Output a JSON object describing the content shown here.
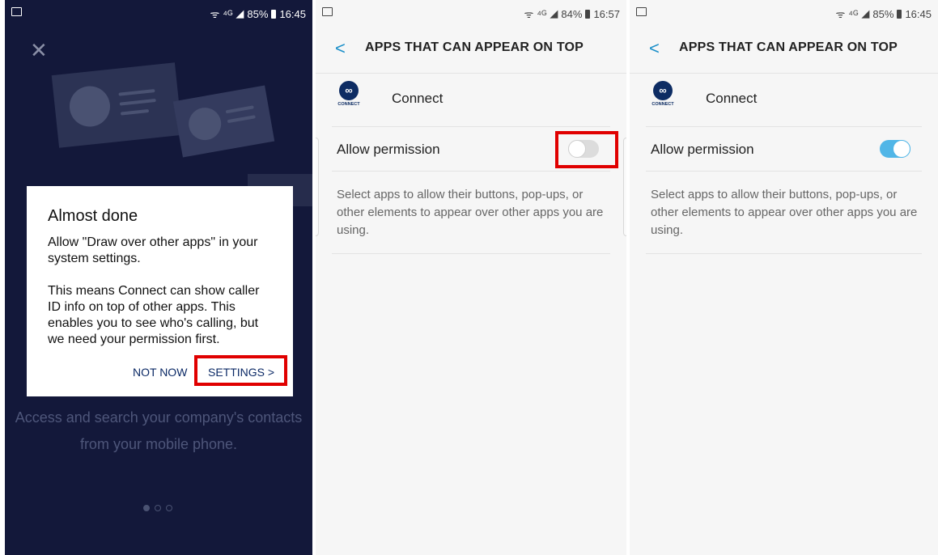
{
  "screen1": {
    "status": {
      "network": "⁴ᴳ",
      "battery": "85%",
      "time": "16:45"
    },
    "close_icon": "✕",
    "dialog": {
      "title": "Almost done",
      "body": "Allow \"Draw over other apps\" in your system settings.\n\nThis means Connect can show caller ID info on top of other apps. This enables you to see who's calling, but we need your permission first.",
      "not_now": "NOT NOW",
      "settings": "SETTINGS >"
    },
    "tagline": "Access and search your company's contacts from your mobile phone.",
    "page_indicator": {
      "count": 3,
      "active": 1
    }
  },
  "screen2": {
    "status": {
      "network": "⁴ᴳ",
      "battery": "84%",
      "time": "16:57"
    },
    "header": {
      "back": "<",
      "title": "APPS THAT CAN APPEAR ON TOP"
    },
    "app": {
      "icon_label": "CONNECT",
      "name": "Connect"
    },
    "permission": {
      "label": "Allow permission",
      "enabled": false
    },
    "description": "Select apps to allow their buttons, pop-ups, or other elements to appear over other apps you are using."
  },
  "screen3": {
    "status": {
      "network": "⁴ᴳ",
      "battery": "85%",
      "time": "16:45"
    },
    "header": {
      "back": "<",
      "title": "APPS THAT CAN APPEAR ON TOP"
    },
    "app": {
      "icon_label": "CONNECT",
      "name": "Connect"
    },
    "permission": {
      "label": "Allow permission",
      "enabled": true
    },
    "description": "Select apps to allow their buttons, pop-ups, or other elements to appear over other apps you are using."
  },
  "colors": {
    "dark_bg": "#13183a",
    "accent_blue": "#51b6e7",
    "highlight_red": "#e00000",
    "brand_navy": "#0c2a66"
  }
}
